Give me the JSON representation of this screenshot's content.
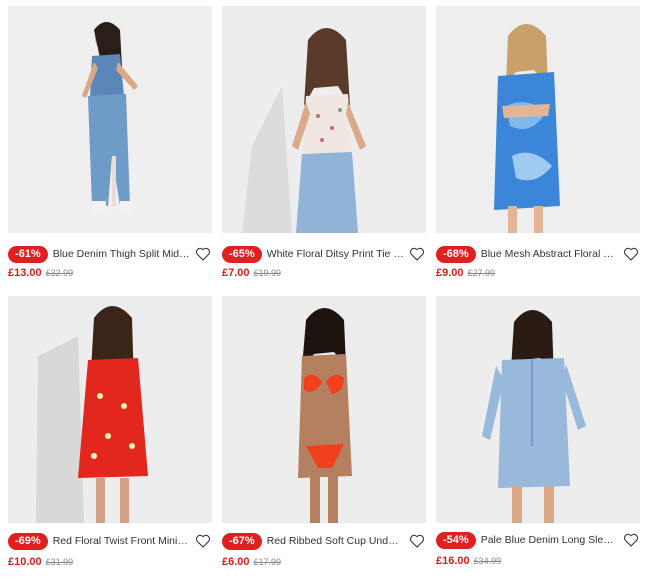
{
  "colors": {
    "sale_badge": "#e0201e",
    "sale_price": "#d6201c",
    "was_price": "#8a8a8a"
  },
  "products": [
    {
      "discount": "-61%",
      "title": "Blue Denim Thigh Split Midi Skirt",
      "price": "£13.00",
      "was": "£32.99",
      "image": "model-blue-denim-midi-skirt"
    },
    {
      "discount": "-65%",
      "title": "White Floral Ditsy Print Tie Neck Cami Top",
      "price": "£7.00",
      "was": "£19.99",
      "image": "model-white-floral-cami"
    },
    {
      "discount": "-68%",
      "title": "Blue Mesh Abstract Floral Mini Dress",
      "price": "£9.00",
      "was": "£27.99",
      "image": "model-blue-mesh-mini-dress"
    },
    {
      "discount": "-69%",
      "title": "Red Floral Twist Front Mini Dress",
      "price": "£10.00",
      "was": "£31.99",
      "image": "model-red-floral-mini-dress"
    },
    {
      "discount": "-67%",
      "title": "Red Ribbed Soft Cup Underwired Bikini Top",
      "price": "£6.00",
      "was": "£17.99",
      "image": "model-red-bikini"
    },
    {
      "discount": "-54%",
      "title": "Pale Blue Denim Long Sleeve Playsuit",
      "price": "£16.00",
      "was": "£34.99",
      "image": "model-pale-blue-denim-playsuit"
    }
  ]
}
